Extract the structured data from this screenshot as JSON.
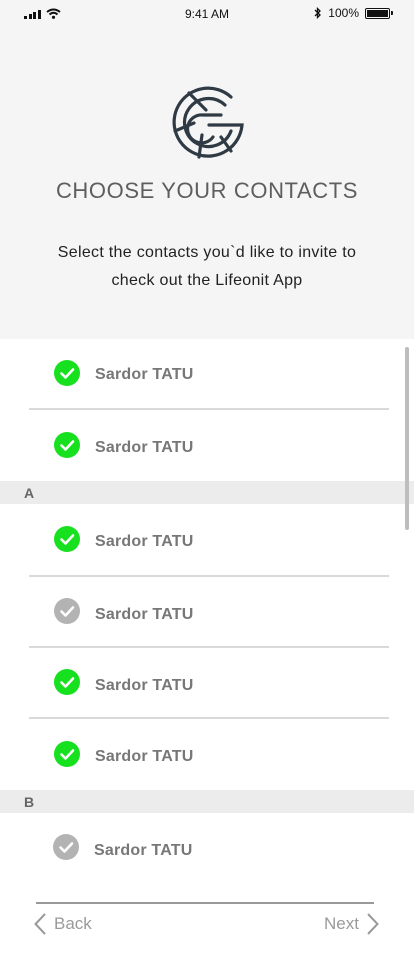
{
  "status_bar": {
    "time": "9:41 AM",
    "battery_text": "100%",
    "battery_level": 1.0
  },
  "header": {
    "title": "CHOOSE YOUR CONTACTS",
    "subtitle_line1": "Select the contacts you`d like to invite to",
    "subtitle_line2": "check out the Lifeonit App"
  },
  "colors": {
    "checked": "#17e01f",
    "unchecked": "#b3b3b3",
    "logo_stroke": "#2f3a45"
  },
  "contacts": [
    {
      "name": "Sardor TATU",
      "checked": true
    },
    {
      "name": "Sardor TATU",
      "checked": true
    },
    {
      "name": "Sardor TATU",
      "checked": true
    },
    {
      "name": "Sardor TATU",
      "checked": false
    },
    {
      "name": "Sardor TATU",
      "checked": true
    },
    {
      "name": "Sardor TATU",
      "checked": true
    },
    {
      "name": "Sardor TATU",
      "checked": false
    }
  ],
  "sections": {
    "a": "A",
    "b": "B"
  },
  "footer": {
    "back_label": "Back",
    "next_label": "Next"
  }
}
